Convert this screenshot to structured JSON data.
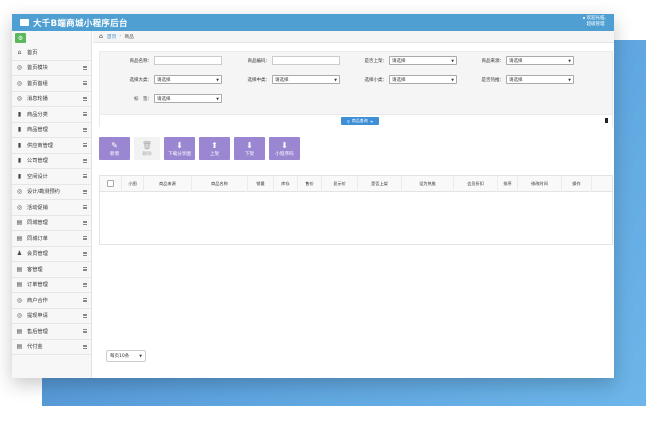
{
  "app": {
    "title": "大千B端商城小程序后台"
  },
  "user": {
    "line1": "欢迎光临,",
    "line2": "超级管理"
  },
  "breadcrumb": {
    "home": "首页",
    "current": "商品"
  },
  "sidebar": {
    "items": [
      {
        "label": "首页",
        "icon": "⌂"
      },
      {
        "label": "首页模块",
        "icon": "◎"
      },
      {
        "label": "首页首组",
        "icon": "◎"
      },
      {
        "label": "消息轮播",
        "icon": "◎"
      },
      {
        "label": "商品分类",
        "icon": "▮"
      },
      {
        "label": "商品管理",
        "icon": "▮"
      },
      {
        "label": "供应商管理",
        "icon": "▮"
      },
      {
        "label": "公司管理",
        "icon": "▮"
      },
      {
        "label": "空间设计",
        "icon": "▮"
      },
      {
        "label": "设计/勘测预约",
        "icon": "◎"
      },
      {
        "label": "活动促销",
        "icon": "◎"
      },
      {
        "label": "同城管理",
        "icon": "▤"
      },
      {
        "label": "同城订单",
        "icon": "▤"
      },
      {
        "label": "会员管理",
        "icon": "♟"
      },
      {
        "label": "客管理",
        "icon": "▤"
      },
      {
        "label": "订单管理",
        "icon": "▤"
      },
      {
        "label": "商户合作",
        "icon": "◎"
      },
      {
        "label": "提现申请",
        "icon": "◎"
      },
      {
        "label": "售后管理",
        "icon": "▤"
      },
      {
        "label": "代付金",
        "icon": "▤"
      }
    ]
  },
  "filters": {
    "name_label": "商品名称：",
    "code_label": "商品编码：",
    "onsale_label": "是否上架：",
    "source_label": "商品来源：",
    "cat_big_label": "选择大类：",
    "cat_mid_label": "选择中类：",
    "cat_small_label": "选择小类：",
    "hot_label": "是否热推：",
    "tag_label": "标　签：",
    "placeholder": "请选择"
  },
  "search_label": "商品查询",
  "actions": [
    {
      "label": "新增",
      "icon": "✎",
      "disabled": false
    },
    {
      "label": "删除",
      "icon": "🗑",
      "disabled": true
    },
    {
      "label": "下载分享图",
      "icon": "⬇",
      "disabled": false
    },
    {
      "label": "上架",
      "icon": "⬆",
      "disabled": false
    },
    {
      "label": "下架",
      "icon": "⬇",
      "disabled": false
    },
    {
      "label": "小程序码",
      "icon": "⬇",
      "disabled": false
    }
  ],
  "table": {
    "columns": [
      "小图",
      "商品来源",
      "商品名称",
      "销量",
      "库存",
      "售价",
      "显示价",
      "是否上架",
      "设为热推",
      "会员折扣",
      "排序",
      "修改时间",
      "操作"
    ]
  },
  "pager": {
    "label": "每页10条"
  },
  "colors": {
    "topbar": "#4f9fd3",
    "accent": "#9b86d2",
    "search": "#3e8fd6",
    "backdrop": "#5fa6e0"
  }
}
